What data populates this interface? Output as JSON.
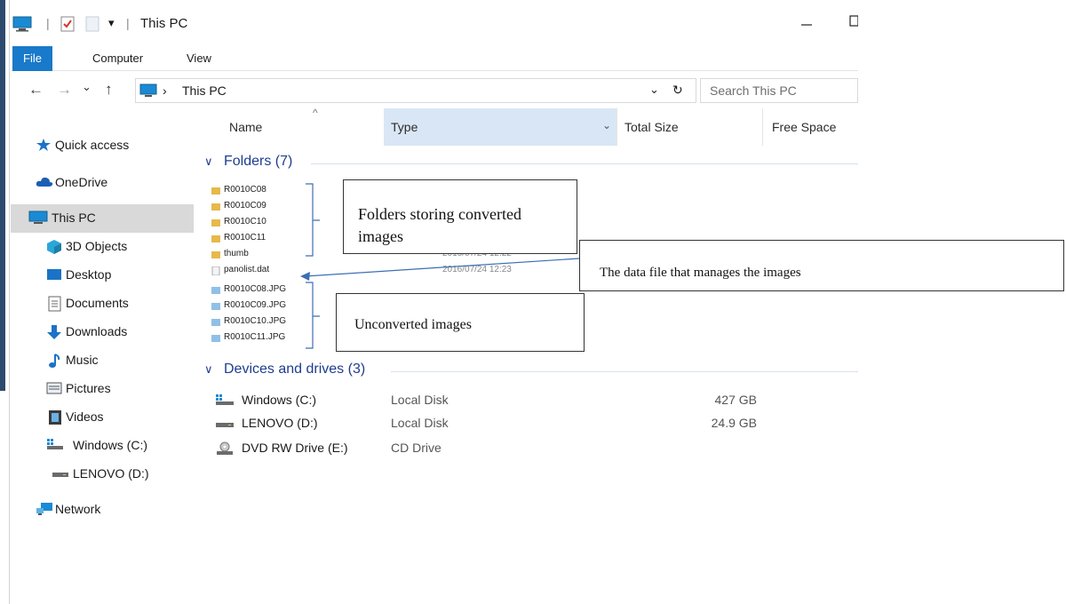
{
  "window": {
    "title": "This PC",
    "qa_separator": "|",
    "qa_dropdown": "▾"
  },
  "ribbon": {
    "tabs": [
      "File",
      "Computer",
      "View"
    ]
  },
  "nav": {
    "back": "←",
    "forward": "→",
    "recent": "⌄",
    "up": "↑",
    "breadcrumb_sep": "›",
    "address": "This PC",
    "address_dropdown": "⌄",
    "refresh": "↻",
    "search_placeholder": "Search This PC"
  },
  "sidebar": {
    "items": [
      {
        "label": "Quick access",
        "icon": "star-icon"
      },
      {
        "label": "OneDrive",
        "icon": "cloud-icon"
      },
      {
        "label": "This PC",
        "icon": "computer-icon",
        "selected": true
      },
      {
        "label": "3D Objects",
        "icon": "cube-icon"
      },
      {
        "label": "Desktop",
        "icon": "desktop-icon"
      },
      {
        "label": "Documents",
        "icon": "document-icon"
      },
      {
        "label": "Downloads",
        "icon": "download-icon"
      },
      {
        "label": "Music",
        "icon": "music-icon"
      },
      {
        "label": "Pictures",
        "icon": "pictures-icon"
      },
      {
        "label": "Videos",
        "icon": "video-icon"
      },
      {
        "label": "Windows (C:)",
        "icon": "windows-drive-icon"
      },
      {
        "label": "LENOVO (D:)",
        "icon": "drive-icon"
      },
      {
        "label": "Network",
        "icon": "network-icon"
      }
    ]
  },
  "columns": [
    "Name",
    "Type",
    "Total Size",
    "Free Space"
  ],
  "sort_indicator": "^",
  "type_dropdown": "⌄",
  "groups": {
    "folders": {
      "label": "Folders (7)",
      "chevron": "∨"
    },
    "drives": {
      "label": "Devices and drives (3)",
      "chevron": "∨"
    }
  },
  "files": [
    {
      "name": "R0010C08",
      "kind": "folder",
      "date": ""
    },
    {
      "name": "R0010C09",
      "kind": "folder",
      "date": ""
    },
    {
      "name": "R0010C10",
      "kind": "folder",
      "date": ""
    },
    {
      "name": "R0010C11",
      "kind": "folder",
      "date": ""
    },
    {
      "name": "thumb",
      "kind": "folder",
      "date": "2016/07/24 12:22"
    },
    {
      "name": "panolist.dat",
      "kind": "file",
      "date": "2016/07/24 12:23"
    },
    {
      "name": "R0010C08.JPG",
      "kind": "image",
      "date": ""
    },
    {
      "name": "R0010C09.JPG",
      "kind": "image",
      "date": ""
    },
    {
      "name": "R0010C10.JPG",
      "kind": "image",
      "date": ""
    },
    {
      "name": "R0010C11.JPG",
      "kind": "image",
      "date": ""
    }
  ],
  "drives": [
    {
      "name": "Windows (C:)",
      "type": "Local Disk",
      "size": "427 GB",
      "icon": "windows-drive-icon"
    },
    {
      "name": "LENOVO (D:)",
      "type": "Local Disk",
      "size": "24.9 GB",
      "icon": "drive-icon"
    },
    {
      "name": "DVD RW Drive (E:)",
      "type": "CD Drive",
      "size": "",
      "icon": "dvd-drive-icon"
    }
  ],
  "annotations": {
    "folders_callout": "Folders storing converted images",
    "datafile_callout": "The data file that manages the images",
    "unconverted_callout": "Unconverted images"
  }
}
